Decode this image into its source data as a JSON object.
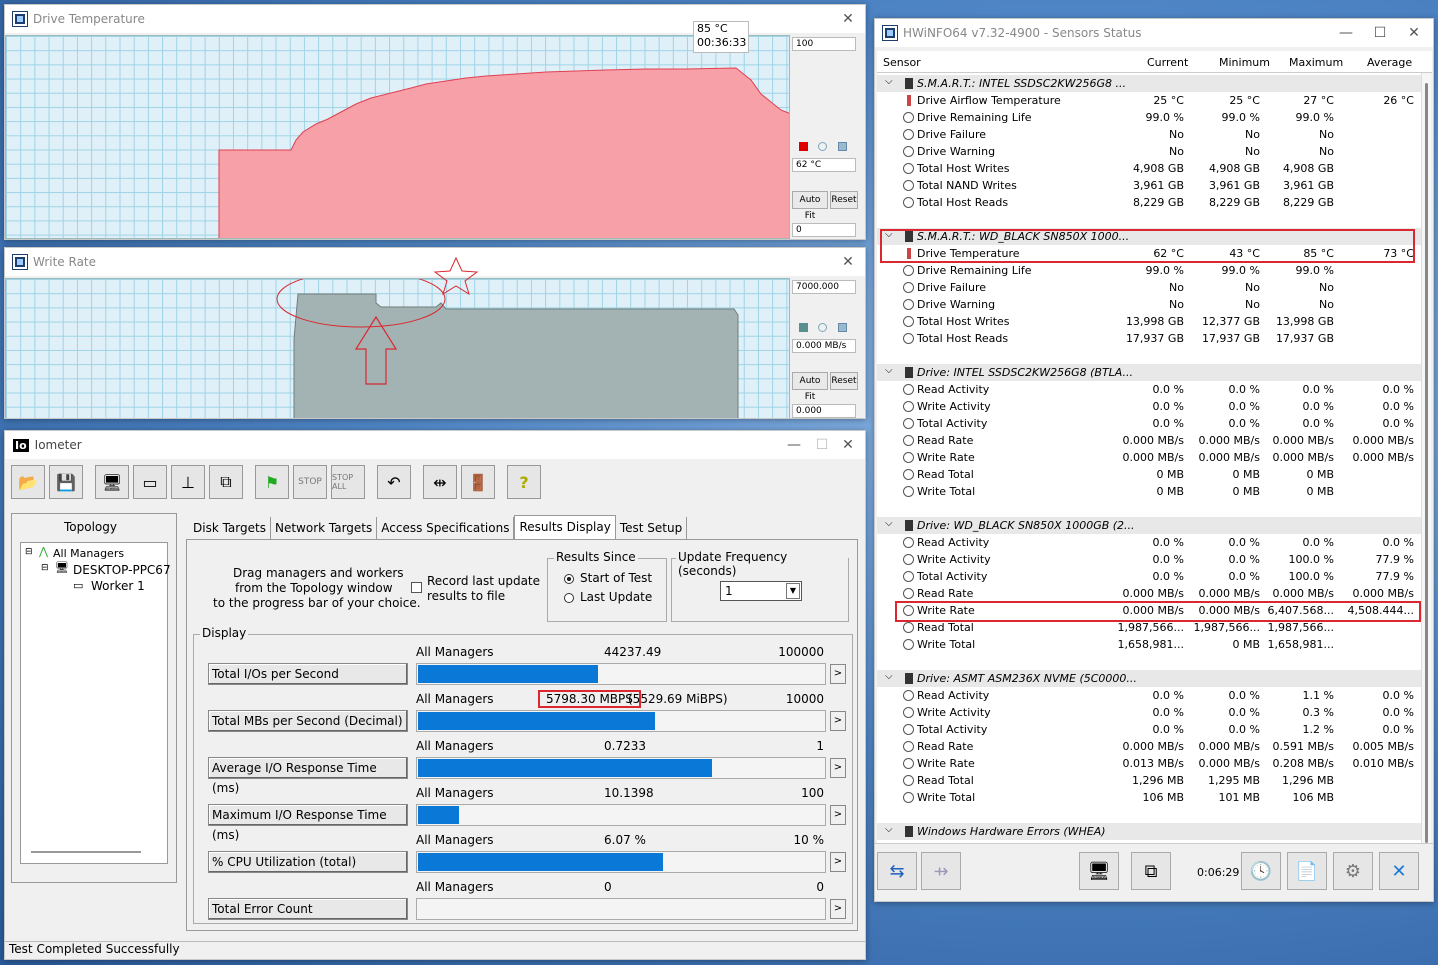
{
  "temp_window": {
    "title": "Drive Temperature",
    "tooltip_value": "85 °C",
    "tooltip_time": "00:36:33",
    "max_label": "100",
    "current_label": "62 °C",
    "min_label": "0",
    "autofit": "Auto Fit",
    "reset": "Reset"
  },
  "rate_window": {
    "title": "Write Rate",
    "max_label": "7000.000",
    "current_label": "0.000 MB/s",
    "min_label": "0.000",
    "autofit": "Auto Fit",
    "reset": "Reset"
  },
  "iometer": {
    "title": "Iometer",
    "topology_label": "Topology",
    "tree": [
      "All Managers",
      "DESKTOP-PPC67",
      "Worker 1"
    ],
    "tabs": [
      "Disk Targets",
      "Network Targets",
      "Access Specifications",
      "Results Display",
      "Test Setup"
    ],
    "drag_text_1": "Drag managers and workers",
    "drag_text_2": "from the Topology window",
    "drag_text_3": "to the progress bar of your choice.",
    "record_1": "Record last update",
    "record_2": "results to file",
    "results_since": "Results Since",
    "start_of_test": "Start of Test",
    "last_update": "Last Update",
    "update_freq": "Update Frequency (seconds)",
    "update_freq_value": "1",
    "display_label": "Display",
    "metrics": [
      {
        "label": "Total I/Os per Second",
        "scope": "All Managers",
        "value": "44237.49",
        "max": "100000",
        "fill": 0.44
      },
      {
        "label": "Total MBs per Second (Decimal)",
        "scope": "All Managers",
        "value": "5798.30 MBPS",
        "value2": "(5529.69 MiBPS)",
        "max": "10000",
        "fill": 0.58
      },
      {
        "label": "Average I/O Response Time (ms)",
        "scope": "All Managers",
        "value": "0.7233",
        "max": "1",
        "fill": 0.72
      },
      {
        "label": "Maximum I/O Response Time (ms)",
        "scope": "All Managers",
        "value": "10.1398",
        "max": "100",
        "fill": 0.1
      },
      {
        "label": "% CPU Utilization (total)",
        "scope": "All Managers",
        "value": "6.07 %",
        "max": "10 %",
        "fill": 0.6
      },
      {
        "label": "Total Error Count",
        "scope": "All Managers",
        "value": "0",
        "max": "0",
        "fill": 0
      }
    ],
    "status": "Test Completed Successfully"
  },
  "hwinfo": {
    "title": "HWiNFO64 v7.32-4900 - Sensors Status",
    "columns": [
      "Sensor",
      "Current",
      "Minimum",
      "Maximum",
      "Average"
    ],
    "rows": [
      {
        "g": true,
        "name": "S.M.A.R.T.: INTEL SSDSC2KW256G8 ..."
      },
      {
        "name": "Drive Airflow Temperature",
        "t": true,
        "cur": "25 °C",
        "min": "25 °C",
        "max": "27 °C",
        "avg": "26 °C"
      },
      {
        "name": "Drive Remaining Life",
        "cur": "99.0 %",
        "min": "99.0 %",
        "max": "99.0 %",
        "avg": ""
      },
      {
        "name": "Drive Failure",
        "cur": "No",
        "min": "No",
        "max": "No",
        "avg": ""
      },
      {
        "name": "Drive Warning",
        "cur": "No",
        "min": "No",
        "max": "No",
        "avg": ""
      },
      {
        "name": "Total Host Writes",
        "cur": "4,908 GB",
        "min": "4,908 GB",
        "max": "4,908 GB",
        "avg": ""
      },
      {
        "name": "Total NAND Writes",
        "cur": "3,961 GB",
        "min": "3,961 GB",
        "max": "3,961 GB",
        "avg": ""
      },
      {
        "name": "Total Host Reads",
        "cur": "8,229 GB",
        "min": "8,229 GB",
        "max": "8,229 GB",
        "avg": ""
      },
      {
        "sp": true
      },
      {
        "g": true,
        "name": "S.M.A.R.T.: WD_BLACK SN850X 1000..."
      },
      {
        "name": "Drive Temperature",
        "t": true,
        "cur": "62 °C",
        "min": "43 °C",
        "max": "85 °C",
        "avg": "73 °C"
      },
      {
        "name": "Drive Remaining Life",
        "cur": "99.0 %",
        "min": "99.0 %",
        "max": "99.0 %",
        "avg": ""
      },
      {
        "name": "Drive Failure",
        "cur": "No",
        "min": "No",
        "max": "No",
        "avg": ""
      },
      {
        "name": "Drive Warning",
        "cur": "No",
        "min": "No",
        "max": "No",
        "avg": ""
      },
      {
        "name": "Total Host Writes",
        "cur": "13,998 GB",
        "min": "12,377 GB",
        "max": "13,998 GB",
        "avg": ""
      },
      {
        "name": "Total Host Reads",
        "cur": "17,937 GB",
        "min": "17,937 GB",
        "max": "17,937 GB",
        "avg": ""
      },
      {
        "sp": true
      },
      {
        "g": true,
        "name": "Drive: INTEL SSDSC2KW256G8 (BTLA..."
      },
      {
        "name": "Read Activity",
        "cur": "0.0 %",
        "min": "0.0 %",
        "max": "0.0 %",
        "avg": "0.0 %"
      },
      {
        "name": "Write Activity",
        "cur": "0.0 %",
        "min": "0.0 %",
        "max": "0.0 %",
        "avg": "0.0 %"
      },
      {
        "name": "Total Activity",
        "cur": "0.0 %",
        "min": "0.0 %",
        "max": "0.0 %",
        "avg": "0.0 %"
      },
      {
        "name": "Read Rate",
        "cur": "0.000 MB/s",
        "min": "0.000 MB/s",
        "max": "0.000 MB/s",
        "avg": "0.000 MB/s"
      },
      {
        "name": "Write Rate",
        "cur": "0.000 MB/s",
        "min": "0.000 MB/s",
        "max": "0.000 MB/s",
        "avg": "0.000 MB/s"
      },
      {
        "name": "Read Total",
        "cur": "0 MB",
        "min": "0 MB",
        "max": "0 MB",
        "avg": ""
      },
      {
        "name": "Write Total",
        "cur": "0 MB",
        "min": "0 MB",
        "max": "0 MB",
        "avg": ""
      },
      {
        "sp": true
      },
      {
        "g": true,
        "name": "Drive: WD_BLACK SN850X 1000GB (2..."
      },
      {
        "name": "Read Activity",
        "cur": "0.0 %",
        "min": "0.0 %",
        "max": "0.0 %",
        "avg": "0.0 %"
      },
      {
        "name": "Write Activity",
        "cur": "0.0 %",
        "min": "0.0 %",
        "max": "100.0 %",
        "avg": "77.9 %"
      },
      {
        "name": "Total Activity",
        "cur": "0.0 %",
        "min": "0.0 %",
        "max": "100.0 %",
        "avg": "77.9 %"
      },
      {
        "name": "Read Rate",
        "cur": "0.000 MB/s",
        "min": "0.000 MB/s",
        "max": "0.000 MB/s",
        "avg": "0.000 MB/s"
      },
      {
        "name": "Write Rate",
        "cur": "0.000 MB/s",
        "min": "0.000 MB/s",
        "max": "6,407.568...",
        "avg": "4,508.444..."
      },
      {
        "name": "Read Total",
        "cur": "1,987,566...",
        "min": "1,987,566...",
        "max": "1,987,566...",
        "avg": ""
      },
      {
        "name": "Write Total",
        "cur": "1,658,981...",
        "min": "0 MB",
        "max": "1,658,981...",
        "avg": ""
      },
      {
        "sp": true
      },
      {
        "g": true,
        "name": "Drive: ASMT ASM236X NVME (5C0000..."
      },
      {
        "name": "Read Activity",
        "cur": "0.0 %",
        "min": "0.0 %",
        "max": "1.1 %",
        "avg": "0.0 %"
      },
      {
        "name": "Write Activity",
        "cur": "0.0 %",
        "min": "0.0 %",
        "max": "0.3 %",
        "avg": "0.0 %"
      },
      {
        "name": "Total Activity",
        "cur": "0.0 %",
        "min": "0.0 %",
        "max": "1.2 %",
        "avg": "0.0 %"
      },
      {
        "name": "Read Rate",
        "cur": "0.000 MB/s",
        "min": "0.000 MB/s",
        "max": "0.591 MB/s",
        "avg": "0.005 MB/s"
      },
      {
        "name": "Write Rate",
        "cur": "0.013 MB/s",
        "min": "0.000 MB/s",
        "max": "0.208 MB/s",
        "avg": "0.010 MB/s"
      },
      {
        "name": "Read Total",
        "cur": "1,296 MB",
        "min": "1,295 MB",
        "max": "1,296 MB",
        "avg": ""
      },
      {
        "name": "Write Total",
        "cur": "106 MB",
        "min": "101 MB",
        "max": "106 MB",
        "avg": ""
      },
      {
        "sp": true
      },
      {
        "g": true,
        "name": "Windows Hardware Errors (WHEA)"
      }
    ],
    "elapsed": "0:06:29"
  }
}
